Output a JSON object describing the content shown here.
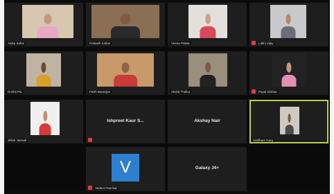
{
  "meeting": {
    "participants": [
      {
        "name": "Anika Sahni",
        "muted": false,
        "type": "video",
        "wall": "#d7c7b0",
        "shirt": "#e7a9c6",
        "skin": "#c99779"
      },
      {
        "name": "Prakash Kollan",
        "muted": false,
        "type": "video",
        "wall": "#8b6f55",
        "shirt": "#2a2a2a",
        "skin": "#7d5a42"
      },
      {
        "name": "Veena Patwa",
        "muted": false,
        "type": "video",
        "wall": "#e3e0dc",
        "shirt": "#d84a5a",
        "skin": "#caa187"
      },
      {
        "name": "Lakhi Vijay",
        "muted": true,
        "type": "video",
        "wall": "#c9c9cc",
        "shirt": "#6a6e78",
        "skin": "#b88866"
      },
      {
        "name": "Drishti Pai",
        "muted": false,
        "type": "video",
        "wall": "#bfb4a1",
        "shirt": "#d6a12a",
        "skin": "#6b4a33"
      },
      {
        "name": "Parth Banerjee",
        "muted": false,
        "type": "video",
        "wall": "#c89a6a",
        "shirt": "#c73b3b",
        "skin": "#8c6348"
      },
      {
        "name": "Akshit Thakur",
        "muted": false,
        "type": "video",
        "wall": "#9a8e7c",
        "shirt": "#222222",
        "skin": "#7c5a44"
      },
      {
        "name": "Payal Sinhaa",
        "muted": true,
        "type": "video",
        "wall": "#222222",
        "shirt": "#e38fb2",
        "skin": "#c9967a"
      },
      {
        "name": "Shlok Jaiswal",
        "muted": false,
        "type": "video",
        "wall": "#f0f0f0",
        "shirt": "#d63a3a",
        "skin": "#c48d6d"
      },
      {
        "name": "Ishpreet Kaur S...",
        "muted": true,
        "type": "name"
      },
      {
        "name": "Akshay Nair",
        "muted": false,
        "type": "name"
      },
      {
        "name": "Siddhant Garg",
        "muted": false,
        "type": "video",
        "wall": "#cfc9bf",
        "shirt": "#4a4a4a",
        "skin": "#7a5742",
        "speaking": true
      },
      {
        "name": "Vedant Panchal",
        "muted": true,
        "type": "avatar",
        "initial": "V"
      },
      {
        "name": "Galaxy J4+",
        "muted": false,
        "type": "name"
      }
    ]
  },
  "colors": {
    "active_speaker": "#b9d14a",
    "avatar_bg": "#2d7fd0",
    "mute_red": "#e03b3b"
  }
}
